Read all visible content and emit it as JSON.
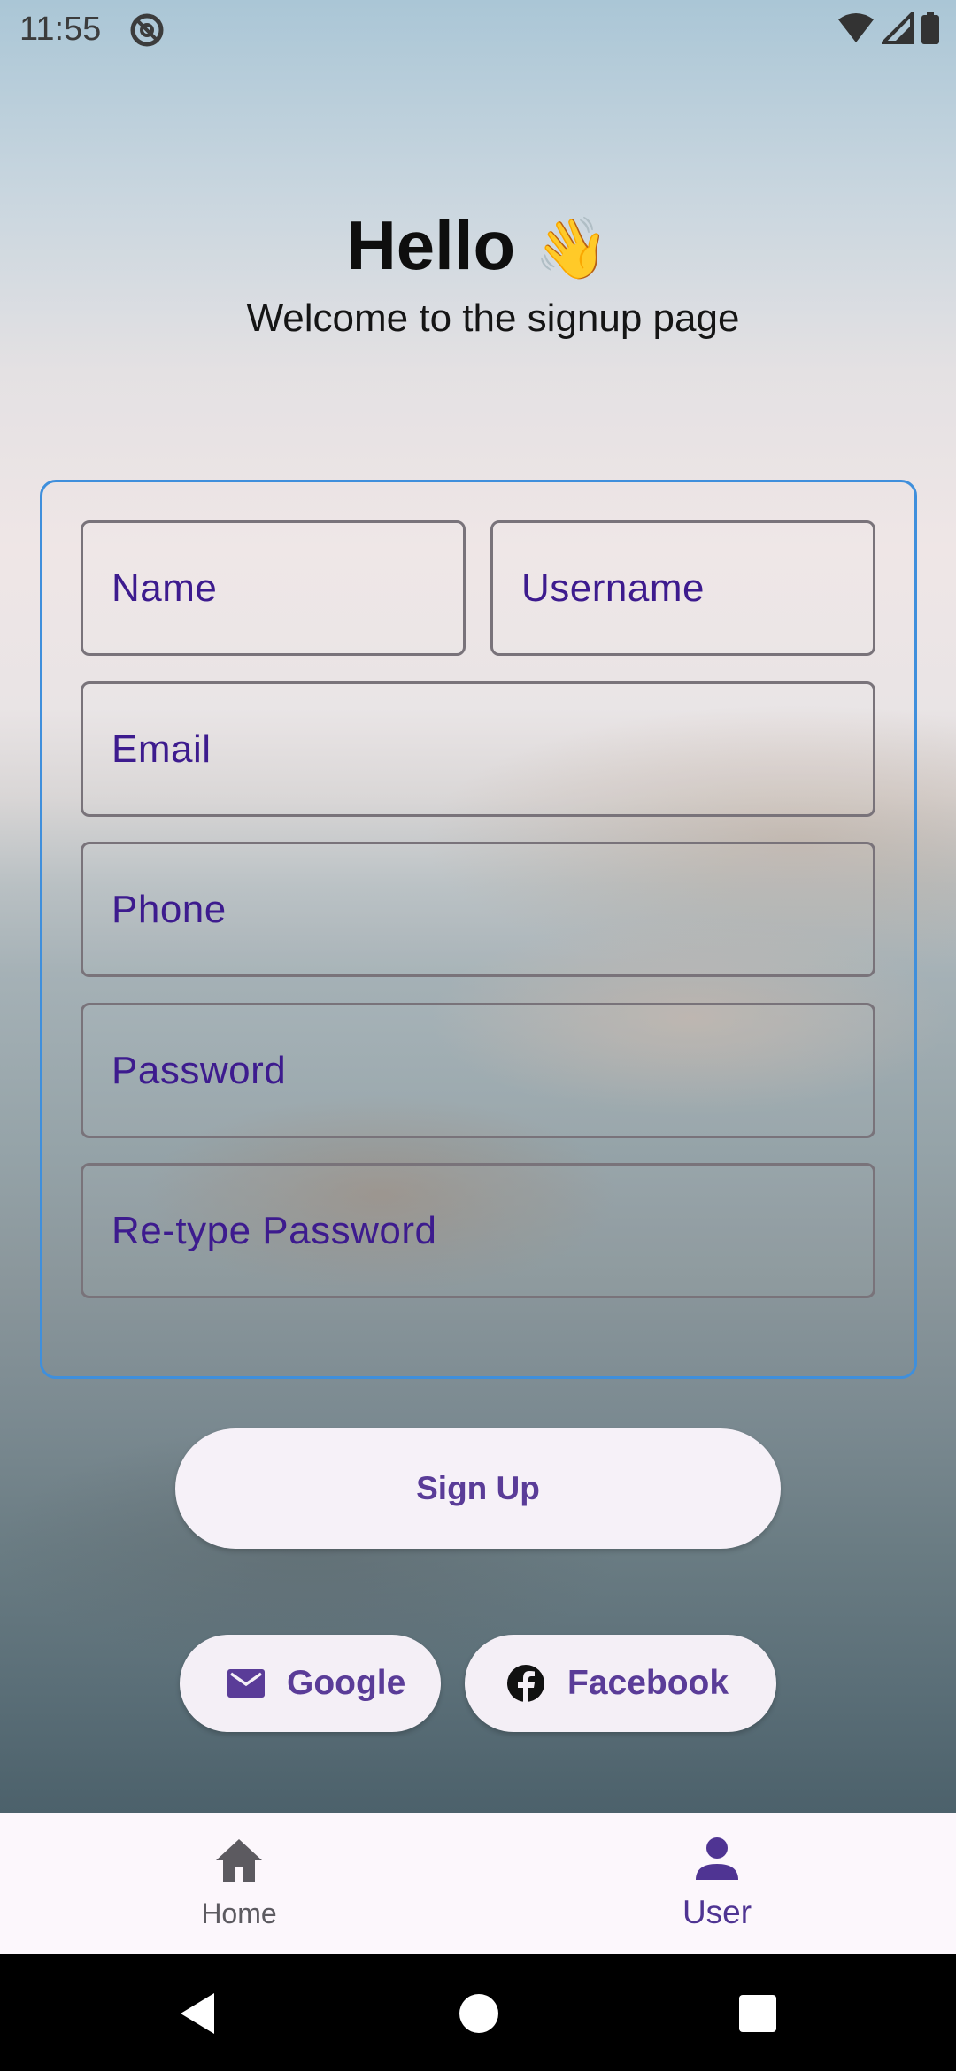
{
  "status_bar": {
    "time": "11:55",
    "icons": [
      "do-not-disturb-icon",
      "wifi-icon",
      "cell-signal-icon",
      "battery-icon"
    ]
  },
  "header": {
    "title": "Hello",
    "title_emoji": "👋",
    "subtitle": "Welcome to the signup page"
  },
  "form": {
    "name_label": "Name",
    "username_label": "Username",
    "email_label": "Email",
    "phone_label": "Phone",
    "password_label": "Password",
    "retype_password_label": "Re-type Password"
  },
  "actions": {
    "signup_label": "Sign Up",
    "google_label": "Google",
    "facebook_label": "Facebook"
  },
  "bottom_nav": {
    "items": [
      {
        "label": "Home",
        "icon": "home-icon",
        "selected": false
      },
      {
        "label": "User",
        "icon": "person-icon",
        "selected": true
      }
    ]
  },
  "colors": {
    "accent": "#5a3c98",
    "label_purple": "#3d1b8e",
    "card_border": "#3f8fdc",
    "field_border": "#79737a"
  }
}
